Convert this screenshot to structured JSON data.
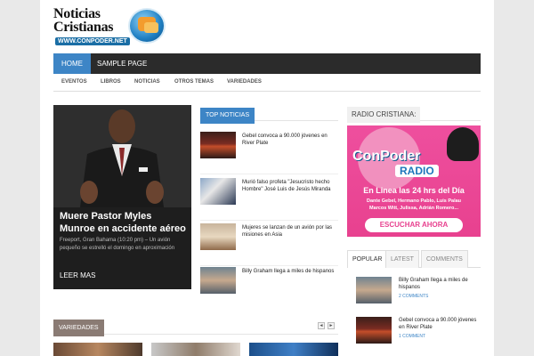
{
  "site": {
    "logo_line1": "Noticias",
    "logo_line2": "Cristianas",
    "logo_url": "WWW.CONPODER.NET"
  },
  "main_nav": [
    {
      "label": "HOME",
      "active": true
    },
    {
      "label": "SAMPLE PAGE",
      "active": false
    }
  ],
  "sub_nav": [
    "EVENTOS",
    "LIBROS",
    "NOTICIAS",
    "OTROS TEMAS",
    "VARIEDADES"
  ],
  "featured": {
    "title": "Muere Pastor Myles Munroe en accidente aéreo",
    "excerpt": "Freeport, Gran Bahama (10:20 pm) – Un avión pequeño se estrelló el domingo en aproximación",
    "more_label": "LEER MAS"
  },
  "top_noticias": {
    "label": "TOP NOTICIAS",
    "items": [
      {
        "title": "Gebel convoca a 90.000 jóvenes en River Plate",
        "thumb": "crowd"
      },
      {
        "title": "Murió falso profeta \"Jesucristo hecho Hombre\" José Luis de Jesús Miranda",
        "thumb": "speaker"
      },
      {
        "title": "Mujeres se lanzan de un avión por las misiones en Asia",
        "thumb": "plane"
      },
      {
        "title": "Billy Graham llega a miles de hispanos",
        "thumb": "graham"
      }
    ]
  },
  "radio": {
    "label": "RADIO CRISTIANA:",
    "banner_brand": "ConPoder",
    "banner_radio": "RADIO",
    "banner_tagline": "En Linea las 24 hrs del Día",
    "banner_names1": "Dante Gebel, Hermano Pablo, Luis Palau",
    "banner_names2": "Marcos Witt, Julissa, Adrián Romero...",
    "banner_button": "ESCUCHAR AHORA"
  },
  "tabs": [
    "POPULAR",
    "LATEST",
    "COMMENTS"
  ],
  "popular": [
    {
      "title": "Billy Graham llega a miles de hispanos",
      "meta": "2 COMMENTS",
      "thumb": "graham"
    },
    {
      "title": "Gebel convoca a 90.000 jóvenes en River Plate",
      "meta": "1 COMMENT",
      "thumb": "crowd"
    }
  ],
  "variedades": {
    "label": "VARIEDADES",
    "prev": "◄",
    "next": "►"
  }
}
